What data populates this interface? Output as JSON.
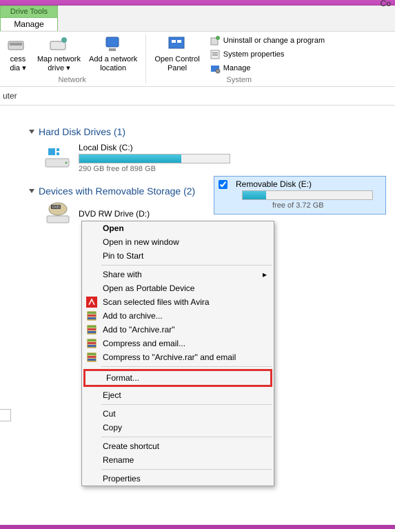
{
  "titlebar": {
    "text": "Co"
  },
  "tabs": {
    "drive_tools": "Drive Tools",
    "manage": "Manage"
  },
  "ribbon": {
    "access_media": {
      "line1": "cess",
      "line2": "dia ▾"
    },
    "map_network": {
      "line1": "Map network",
      "line2": "drive ▾"
    },
    "add_network": {
      "line1": "Add a network",
      "line2": "location"
    },
    "network_group": "Network",
    "open_control": {
      "line1": "Open Control",
      "line2": "Panel"
    },
    "uninstall": "Uninstall or change a program",
    "sysprops": "System properties",
    "manage": "Manage",
    "system_group": "System"
  },
  "breadcrumb": "uter",
  "hdd": {
    "header": "Hard Disk Drives (1)",
    "local_disk": {
      "name": "Local Disk (C:)",
      "free": "290 GB free of 898 GB",
      "fill_pct": 68
    }
  },
  "removable": {
    "header": "Devices with Removable Storage (2)",
    "dvd": "DVD RW Drive (D:)",
    "disk": {
      "name": "Removable Disk (E:)",
      "free": "free of 3.72 GB",
      "fill_pct": 18
    }
  },
  "context_menu": {
    "open": "Open",
    "open_new": "Open in new window",
    "pin": "Pin to Start",
    "share": "Share with",
    "portable": "Open as Portable Device",
    "avira": "Scan selected files with Avira",
    "add_archive": "Add to archive...",
    "add_archive_rar": "Add to \"Archive.rar\"",
    "compress_email": "Compress and email...",
    "compress_rar_email": "Compress to \"Archive.rar\" and email",
    "format": "Format...",
    "eject": "Eject",
    "cut": "Cut",
    "copy": "Copy",
    "shortcut": "Create shortcut",
    "rename": "Rename",
    "properties": "Properties"
  }
}
